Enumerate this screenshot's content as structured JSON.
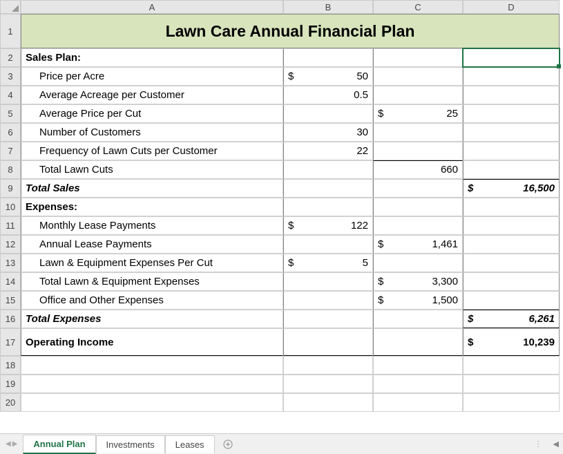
{
  "title": "Lawn Care Annual Financial Plan",
  "cols": [
    "A",
    "B",
    "C",
    "D"
  ],
  "rows": {
    "r2": {
      "a": "Sales Plan:"
    },
    "r3": {
      "a": "Price per Acre",
      "b_sym": "$",
      "b_val": "50"
    },
    "r4": {
      "a": "Average Acreage per Customer",
      "b_val": "0.5"
    },
    "r5": {
      "a": "Average Price per Cut",
      "c_sym": "$",
      "c_val": "25"
    },
    "r6": {
      "a": "Number of Customers",
      "b_val": "30"
    },
    "r7": {
      "a": "Frequency of Lawn Cuts per Customer",
      "b_val": "22"
    },
    "r8": {
      "a": "Total Lawn Cuts",
      "c_val": "660"
    },
    "r9": {
      "a": "Total Sales",
      "d_sym": "$",
      "d_val": "16,500"
    },
    "r10": {
      "a": "Expenses:"
    },
    "r11": {
      "a": "Monthly Lease Payments",
      "b_sym": "$",
      "b_val": "122"
    },
    "r12": {
      "a": "Annual Lease Payments",
      "c_sym": "$",
      "c_val": "1,461"
    },
    "r13": {
      "a": "Lawn & Equipment Expenses Per Cut",
      "b_sym": "$",
      "b_val": "5"
    },
    "r14": {
      "a": "Total Lawn & Equipment Expenses",
      "c_sym": "$",
      "c_val": "3,300"
    },
    "r15": {
      "a": "Office and Other Expenses",
      "c_sym": "$",
      "c_val": "1,500"
    },
    "r16": {
      "a": "Total Expenses",
      "d_sym": "$",
      "d_val": "6,261"
    },
    "r17": {
      "a": "Operating Income",
      "d_sym": "$",
      "d_val": "10,239"
    }
  },
  "tabs": [
    "Annual Plan",
    "Investments",
    "Leases"
  ],
  "chart_data": {
    "type": "table",
    "title": "Lawn Care Annual Financial Plan",
    "sections": [
      {
        "name": "Sales Plan",
        "items": [
          {
            "label": "Price per Acre",
            "value": 50,
            "unit": "$"
          },
          {
            "label": "Average Acreage per Customer",
            "value": 0.5
          },
          {
            "label": "Average Price per Cut",
            "value": 25,
            "unit": "$"
          },
          {
            "label": "Number of Customers",
            "value": 30
          },
          {
            "label": "Frequency of Lawn Cuts per Customer",
            "value": 22
          },
          {
            "label": "Total Lawn Cuts",
            "value": 660
          }
        ],
        "total": {
          "label": "Total Sales",
          "value": 16500,
          "unit": "$"
        }
      },
      {
        "name": "Expenses",
        "items": [
          {
            "label": "Monthly Lease Payments",
            "value": 122,
            "unit": "$"
          },
          {
            "label": "Annual Lease Payments",
            "value": 1461,
            "unit": "$"
          },
          {
            "label": "Lawn & Equipment Expenses Per Cut",
            "value": 5,
            "unit": "$"
          },
          {
            "label": "Total Lawn & Equipment Expenses",
            "value": 3300,
            "unit": "$"
          },
          {
            "label": "Office and Other Expenses",
            "value": 1500,
            "unit": "$"
          }
        ],
        "total": {
          "label": "Total Expenses",
          "value": 6261,
          "unit": "$"
        }
      },
      {
        "name": "Operating Income",
        "total": {
          "label": "Operating Income",
          "value": 10239,
          "unit": "$"
        }
      }
    ]
  }
}
